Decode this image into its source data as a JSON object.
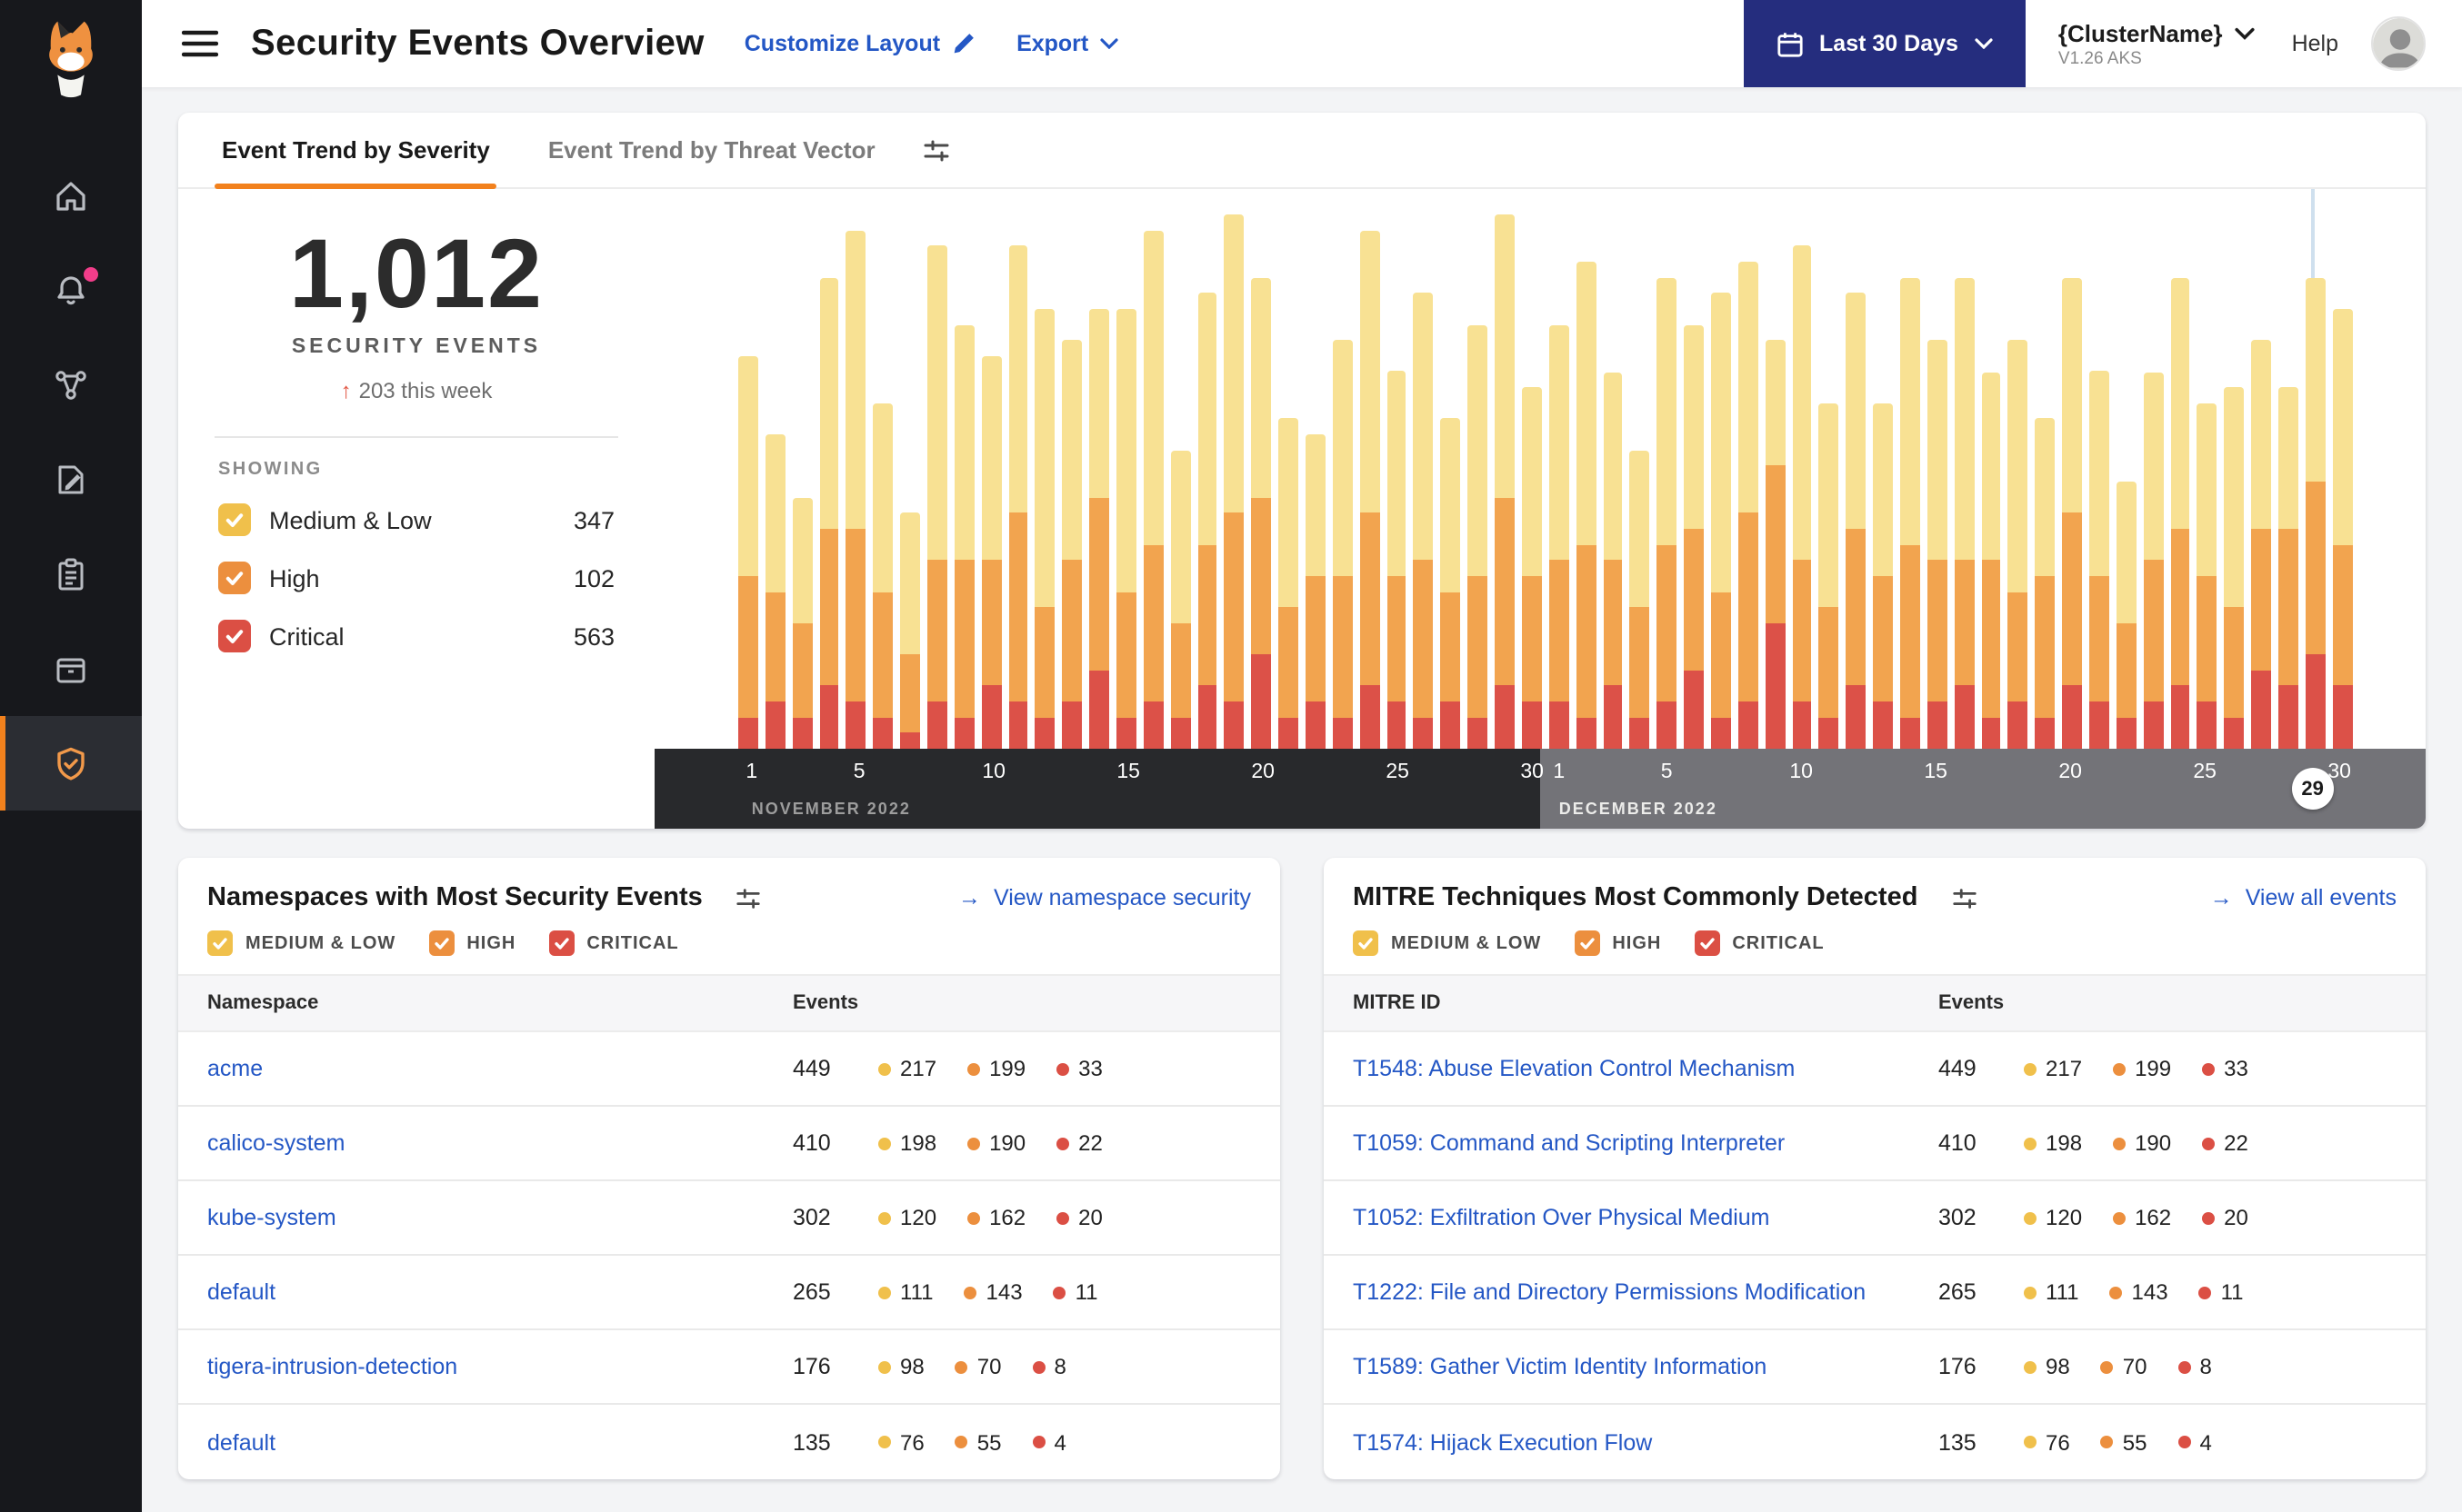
{
  "ui": {
    "link_arrow": "→",
    "arrow_up": "↑"
  },
  "severity_colors": {
    "medium_low": "#F0C04B",
    "high": "#EC8F3E",
    "critical": "#DB4F44"
  },
  "sidebar": {
    "items": [
      {
        "name": "home"
      },
      {
        "name": "alerts",
        "badge": true
      },
      {
        "name": "service-graph"
      },
      {
        "name": "policies"
      },
      {
        "name": "compliance"
      },
      {
        "name": "workloads"
      },
      {
        "name": "threat-defense",
        "active": true
      }
    ]
  },
  "header": {
    "title": "Security Events Overview",
    "customize_label": "Customize Layout",
    "export_label": "Export",
    "date_range_label": "Last 30 Days",
    "cluster_name": "{ClusterName}",
    "cluster_version": "V1.26 AKS",
    "help_label": "Help"
  },
  "trend_card": {
    "tabs": [
      {
        "label": "Event Trend by Severity",
        "active": true
      },
      {
        "label": "Event Trend by Threat Vector",
        "active": false
      }
    ],
    "total": "1,012",
    "total_label": "SECURITY EVENTS",
    "delta": "203 this week",
    "showing_label": "SHOWING",
    "legend": [
      {
        "label": "Medium & Low",
        "count": 347,
        "color": "#F0C04B"
      },
      {
        "label": "High",
        "count": 102,
        "color": "#EC8F3E"
      },
      {
        "label": "Critical",
        "count": 563,
        "color": "#DB4F44"
      }
    ]
  },
  "chart_data": {
    "type": "bar",
    "stacked": true,
    "title": "Event Trend by Severity",
    "series_keys": [
      "medium_low",
      "high",
      "critical"
    ],
    "colors": {
      "medium_low": "#F8E193",
      "high": "#F2A44F",
      "critical": "#DC5148"
    },
    "months": [
      {
        "label": "NOVEMBER 2022",
        "days": 30,
        "ticks": [
          1,
          5,
          10,
          15,
          20,
          25,
          30
        ]
      },
      {
        "label": "DECEMBER 2022",
        "days": 30,
        "ticks": [
          1,
          5,
          10,
          15,
          20,
          25,
          30
        ]
      }
    ],
    "selected_day": {
      "month_index": 1,
      "day": 29
    },
    "totals": {
      "medium_low": 347,
      "high": 102,
      "critical": 563,
      "all": 1012
    },
    "days": [
      [
        14,
        9,
        2
      ],
      [
        10,
        7,
        3
      ],
      [
        8,
        6,
        2
      ],
      [
        16,
        10,
        4
      ],
      [
        19,
        11,
        3
      ],
      [
        12,
        8,
        2
      ],
      [
        9,
        5,
        1
      ],
      [
        20,
        9,
        3
      ],
      [
        15,
        10,
        2
      ],
      [
        13,
        8,
        4
      ],
      [
        17,
        12,
        3
      ],
      [
        19,
        7,
        2
      ],
      [
        14,
        9,
        3
      ],
      [
        12,
        11,
        5
      ],
      [
        18,
        8,
        2
      ],
      [
        20,
        10,
        3
      ],
      [
        11,
        6,
        2
      ],
      [
        16,
        9,
        4
      ],
      [
        19,
        12,
        3
      ],
      [
        14,
        10,
        6
      ],
      [
        12,
        7,
        2
      ],
      [
        9,
        8,
        3
      ],
      [
        15,
        9,
        2
      ],
      [
        18,
        11,
        4
      ],
      [
        13,
        8,
        3
      ],
      [
        17,
        10,
        2
      ],
      [
        11,
        7,
        3
      ],
      [
        16,
        9,
        2
      ],
      [
        18,
        12,
        4
      ],
      [
        12,
        8,
        3
      ],
      [
        15,
        9,
        3
      ],
      [
        18,
        11,
        2
      ],
      [
        12,
        8,
        4
      ],
      [
        10,
        7,
        2
      ],
      [
        17,
        10,
        3
      ],
      [
        13,
        9,
        5
      ],
      [
        19,
        8,
        2
      ],
      [
        16,
        12,
        3
      ],
      [
        8,
        10,
        8
      ],
      [
        20,
        9,
        3
      ],
      [
        13,
        7,
        2
      ],
      [
        15,
        10,
        4
      ],
      [
        11,
        8,
        3
      ],
      [
        17,
        11,
        2
      ],
      [
        14,
        9,
        3
      ],
      [
        18,
        8,
        4
      ],
      [
        12,
        10,
        2
      ],
      [
        16,
        7,
        3
      ],
      [
        10,
        9,
        2
      ],
      [
        15,
        11,
        4
      ],
      [
        13,
        8,
        3
      ],
      [
        9,
        6,
        2
      ],
      [
        12,
        9,
        3
      ],
      [
        16,
        10,
        4
      ],
      [
        11,
        8,
        3
      ],
      [
        14,
        7,
        2
      ],
      [
        12,
        9,
        5
      ],
      [
        9,
        10,
        4
      ],
      [
        13,
        11,
        6
      ],
      [
        15,
        9,
        4
      ]
    ]
  },
  "severity_filters": [
    {
      "label": "MEDIUM & LOW",
      "color": "#F0C04B",
      "checked": true
    },
    {
      "label": "HIGH",
      "color": "#EC8F3E",
      "checked": true
    },
    {
      "label": "CRITICAL",
      "color": "#DB4F44",
      "checked": true
    }
  ],
  "namespaces_card": {
    "title": "Namespaces with Most Security Events",
    "link_label": "View namespace security",
    "columns": [
      "Namespace",
      "Events"
    ],
    "rows": [
      {
        "name": "acme",
        "total": 449,
        "by_severity": [
          217,
          199,
          33
        ]
      },
      {
        "name": "calico-system",
        "total": 410,
        "by_severity": [
          198,
          190,
          22
        ]
      },
      {
        "name": "kube-system",
        "total": 302,
        "by_severity": [
          120,
          162,
          20
        ]
      },
      {
        "name": "default",
        "total": 265,
        "by_severity": [
          111,
          143,
          11
        ]
      },
      {
        "name": "tigera-intrusion-detection",
        "total": 176,
        "by_severity": [
          98,
          70,
          8
        ]
      },
      {
        "name": "default",
        "total": 135,
        "by_severity": [
          76,
          55,
          4
        ]
      }
    ]
  },
  "mitre_card": {
    "title": "MITRE Techniques Most Commonly Detected",
    "link_label": "View all events",
    "columns": [
      "MITRE ID",
      "Events"
    ],
    "rows": [
      {
        "name": "T1548: Abuse Elevation Control Mechanism",
        "total": 449,
        "by_severity": [
          217,
          199,
          33
        ]
      },
      {
        "name": "T1059: Command and Scripting Interpreter",
        "total": 410,
        "by_severity": [
          198,
          190,
          22
        ]
      },
      {
        "name": "T1052: Exfiltration Over Physical Medium",
        "total": 302,
        "by_severity": [
          120,
          162,
          20
        ]
      },
      {
        "name": "T1222: File and Directory Permissions Modification",
        "total": 265,
        "by_severity": [
          111,
          143,
          11
        ]
      },
      {
        "name": "T1589: Gather Victim Identity Information",
        "total": 176,
        "by_severity": [
          98,
          70,
          8
        ]
      },
      {
        "name": "T1574: Hijack Execution Flow",
        "total": 135,
        "by_severity": [
          76,
          55,
          4
        ]
      }
    ]
  }
}
